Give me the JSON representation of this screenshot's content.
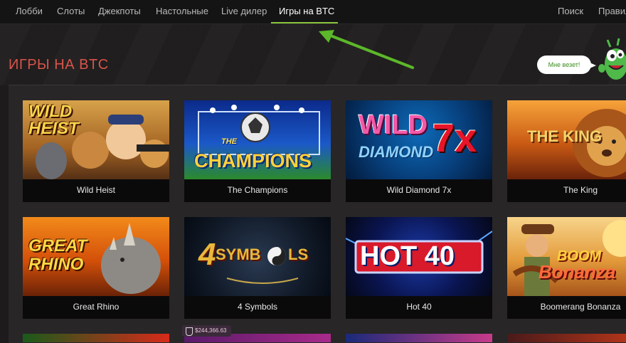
{
  "nav": {
    "items": [
      {
        "label": "Лобби"
      },
      {
        "label": "Слоты"
      },
      {
        "label": "Джекпоты"
      },
      {
        "label": "Настольные"
      },
      {
        "label": "Live дилер"
      },
      {
        "label": "Игры на BTC"
      }
    ],
    "active_index": 5,
    "right": [
      "Поиск",
      "Правила"
    ]
  },
  "page": {
    "title": "ИГРЫ НА BTC",
    "mascot_speech": "Мне везет!"
  },
  "games": [
    {
      "name": "Wild Heist",
      "logo": "WILD HEIST"
    },
    {
      "name": "The Champions",
      "logo": "THE CHAMPIONS"
    },
    {
      "name": "Wild Diamond 7x",
      "logo": "WILD DIAMOND 7x"
    },
    {
      "name": "The King",
      "logo": "THE KING"
    },
    {
      "name": "Great Rhino",
      "logo": "GREAT RHINO"
    },
    {
      "name": "4 Symbols",
      "logo": "4 SYMBOLS"
    },
    {
      "name": "Hot 40",
      "logo": "HOT 40"
    },
    {
      "name": "Boomerang Bonanza",
      "logo": "BOOMERANG BONANZA"
    }
  ],
  "jackpot": {
    "amount": "$244,366.63"
  },
  "colors": {
    "accent": "#8cc63f",
    "title": "#d8544a",
    "background": "#1d1b1c",
    "panel": "#282627"
  }
}
